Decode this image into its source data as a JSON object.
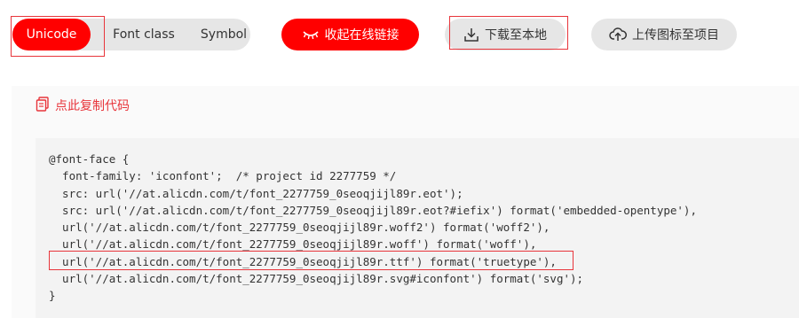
{
  "toolbar": {
    "tabs": [
      "Unicode",
      "Font class",
      "Symbol"
    ],
    "collapse_label": "收起在线链接",
    "download_label": "下载至本地",
    "upload_label": "上传图标至项目"
  },
  "icons": {
    "collapse": "closed-eye-icon",
    "download": "download-icon",
    "upload": "cloud-upload-icon",
    "copy": "copy-document-icon"
  },
  "copy_section": {
    "copy_label": "点此复制代码",
    "code_lines": [
      "@font-face {",
      "  font-family: 'iconfont';  /* project id 2277759 */",
      "  src: url('//at.alicdn.com/t/font_2277759_0seoqjijl89r.eot');",
      "  src: url('//at.alicdn.com/t/font_2277759_0seoqjijl89r.eot?#iefix') format('embedded-opentype'),",
      "  url('//at.alicdn.com/t/font_2277759_0seoqjijl89r.woff2') format('woff2'),",
      "  url('//at.alicdn.com/t/font_2277759_0seoqjijl89r.woff') format('woff'),",
      "  url('//at.alicdn.com/t/font_2277759_0seoqjijl89r.ttf') format('truetype'),",
      "  url('//at.alicdn.com/t/font_2277759_0seoqjijl89r.svg#iconfont') format('svg');",
      "}"
    ]
  },
  "colors": {
    "accent": "#ff0000",
    "link": "#e8353b",
    "pill_gray": "#e6e6e6",
    "code_bg": "#f3f3f3"
  }
}
